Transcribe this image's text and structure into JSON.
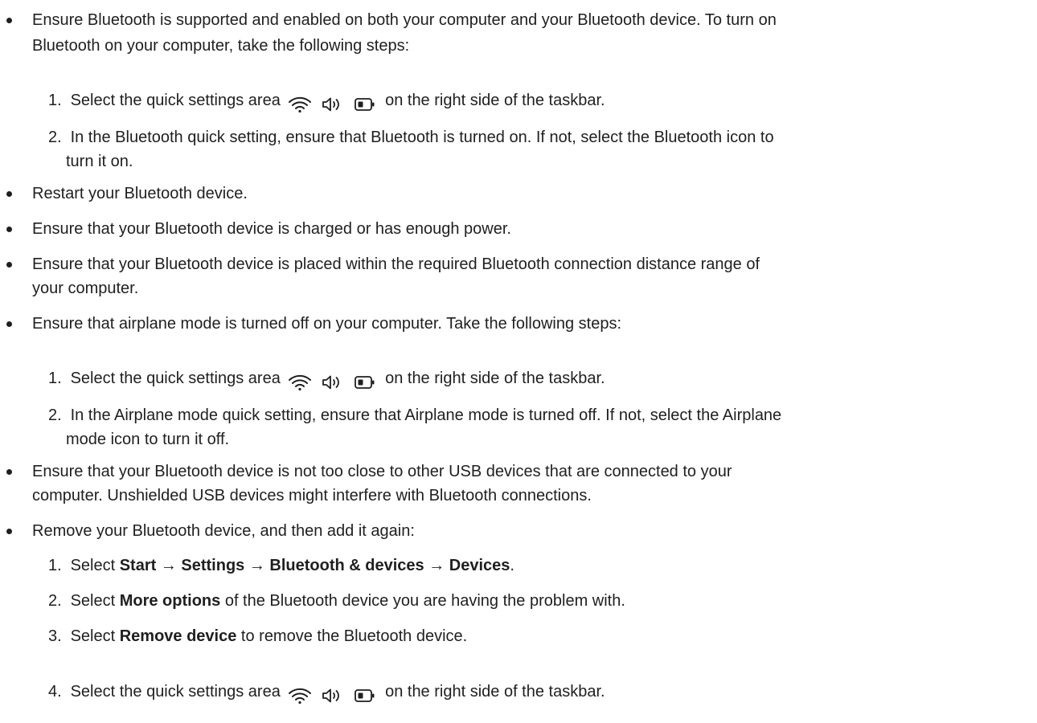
{
  "items": {
    "b1": {
      "line1": "Ensure Bluetooth is supported and enabled on both your computer and your Bluetooth device. To turn on",
      "line2": "Bluetooth on your computer, take the following steps:",
      "steps": {
        "s1_prefix": "Select the quick settings area",
        "s1_suffix": "on the right side of the taskbar.",
        "s2_line1": "In the Bluetooth quick setting, ensure that Bluetooth is turned on. If not, select the Bluetooth icon to",
        "s2_line2": "turn it on."
      }
    },
    "b2": "Restart your Bluetooth device.",
    "b3": "Ensure that your Bluetooth device is charged or has enough power.",
    "b4": {
      "line1": "Ensure that your Bluetooth device is placed within the required Bluetooth connection distance range of",
      "line2": "your computer."
    },
    "b5": {
      "line1": "Ensure that airplane mode is turned off on your computer. Take the following steps:",
      "steps": {
        "s1_prefix": "Select the quick settings area",
        "s1_suffix": "on the right side of the taskbar.",
        "s2_line1": "In the Airplane mode quick setting, ensure that Airplane mode is turned off. If not, select the Airplane",
        "s2_line2": "mode icon to turn it off."
      }
    },
    "b6": {
      "line1": "Ensure that your Bluetooth device is not too close to other USB devices that are connected to your",
      "line2": "computer. Unshielded USB devices might interfere with Bluetooth connections."
    },
    "b7": {
      "line1": "Remove your Bluetooth device, and then add it again:",
      "steps": {
        "s1_a": "Select ",
        "s1_path": "Start → Settings → Bluetooth & devices → Devices",
        "s1_end": ".",
        "s2_a": "Select ",
        "s2_bold": "More options",
        "s2_b": " of the Bluetooth device you are having the problem with.",
        "s3_a": "Select ",
        "s3_bold": "Remove device",
        "s3_b": " to remove the Bluetooth device.",
        "s4_prefix": "Select the quick settings area",
        "s4_suffix": "on the right side of the taskbar."
      }
    }
  },
  "numbers": {
    "n1": "1.",
    "n2": "2.",
    "n3": "3.",
    "n4": "4."
  },
  "icons": [
    "wifi-icon",
    "speaker-icon",
    "battery-icon"
  ]
}
